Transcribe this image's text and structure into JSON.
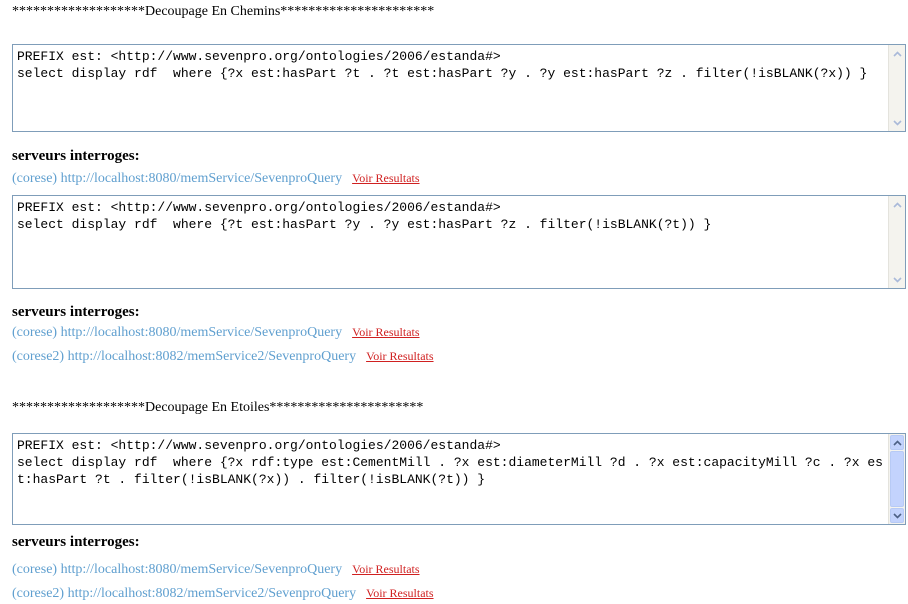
{
  "sections": [
    {
      "title": "*******************Decoupage En Chemins**********************",
      "groups": [
        {
          "query": "PREFIX est: <http://www.sevenpro.org/ontologies/2006/estanda#>\nselect display rdf  where {?x est:hasPart ?t . ?t est:hasPart ?y . ?y est:hasPart ?z . filter(!isBLANK(?x)) }",
          "servers_label": "serveurs interroges:",
          "servers": [
            {
              "name": "(corese) http://localhost:8080/memService/SevenproQuery",
              "link": "Voir Resultats"
            }
          ]
        },
        {
          "query": "PREFIX est: <http://www.sevenpro.org/ontologies/2006/estanda#>\nselect display rdf  where {?t est:hasPart ?y . ?y est:hasPart ?z . filter(!isBLANK(?t)) }",
          "servers_label": "serveurs interroges:",
          "servers": [
            {
              "name": "(corese) http://localhost:8080/memService/SevenproQuery",
              "link": "Voir Resultats"
            },
            {
              "name": "(corese2) http://localhost:8082/memService2/SevenproQuery",
              "link": "Voir Resultats"
            }
          ]
        }
      ]
    },
    {
      "title": "*******************Decoupage En Etoiles**********************",
      "groups": [
        {
          "query": "PREFIX est: <http://www.sevenpro.org/ontologies/2006/estanda#>\nselect display rdf  where {?x rdf:type est:CementMill . ?x est:diameterMill ?d . ?x est:capacityMill ?c . ?x est:hasPart ?t . filter(!isBLANK(?x)) . filter(!isBLANK(?t)) }",
          "servers_label": "serveurs interroges:",
          "servers": [
            {
              "name": "(corese) http://localhost:8080/memService/SevenproQuery",
              "link": "Voir Resultats"
            },
            {
              "name": "(corese2) http://localhost:8082/memService2/SevenproQuery",
              "link": "Voir Resultats"
            }
          ]
        }
      ]
    }
  ],
  "icons": {
    "scroll_up": "chevron-up-icon",
    "scroll_down": "chevron-down-icon"
  },
  "colors": {
    "server_link": "#5f9fcf",
    "voir_link": "#d02020",
    "border": "#7f9db9",
    "scroll_thumb": "#c3d3fd"
  }
}
